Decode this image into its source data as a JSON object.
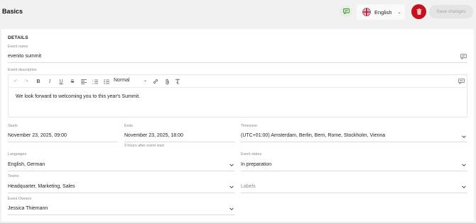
{
  "header": {
    "title": "Basics",
    "language": "English",
    "save_label": "Save changes"
  },
  "details": {
    "section_title": "DETAILS",
    "event_name": {
      "label": "Event name",
      "value": "evenito summit"
    },
    "event_description": {
      "label": "Event description",
      "format": "Normal",
      "text": "We look forward to welcoming you to this year's Summit."
    },
    "starts": {
      "label": "Starts",
      "value": "November 23, 2025, 09:00"
    },
    "ends": {
      "label": "Ends",
      "value": "November 23, 2025, 18:00",
      "hint": "9 hours after event start"
    },
    "timezone": {
      "label": "Timezone",
      "value": "(UTC+01:00) Amsterdam, Berlin, Bern, Rome, Stockholm, Vienna"
    },
    "languages": {
      "label": "Languages",
      "value": "English, German"
    },
    "event_status": {
      "label": "Event status",
      "value": "In preparation"
    },
    "teams": {
      "label": "Teams",
      "value": "Headquarter, Marketing, Sales"
    },
    "labels": {
      "placeholder": "Labels"
    },
    "event_owners": {
      "label": "Event Owners",
      "value": "Jessica Thiemann"
    }
  },
  "colors": {
    "accent_red": "#c80f1e",
    "background": "#f1f1f1",
    "card": "#ffffff"
  },
  "icons": [
    "translate-icon",
    "uk-flag-icon",
    "chevron-down-icon",
    "trash-icon",
    "undo-icon",
    "redo-icon",
    "bold-icon",
    "italic-icon",
    "underline-icon",
    "strikethrough-icon",
    "align-left-icon",
    "ordered-list-icon",
    "bullet-list-icon",
    "link-icon",
    "attachment-icon",
    "clear-format-icon"
  ]
}
